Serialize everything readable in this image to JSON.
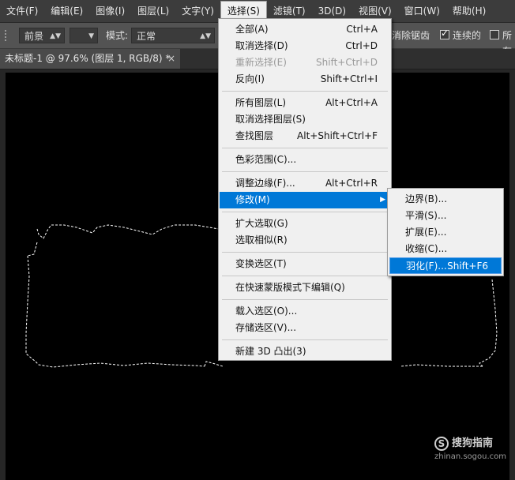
{
  "menubar": {
    "items": [
      {
        "label": "文件(F)"
      },
      {
        "label": "编辑(E)"
      },
      {
        "label": "图像(I)"
      },
      {
        "label": "图层(L)"
      },
      {
        "label": "文字(Y)"
      },
      {
        "label": "选择(S)",
        "active": true
      },
      {
        "label": "滤镜(T)"
      },
      {
        "label": "3D(D)"
      },
      {
        "label": "视图(V)"
      },
      {
        "label": "窗口(W)"
      },
      {
        "label": "帮助(H)"
      }
    ]
  },
  "options": {
    "fill_source": "前景",
    "mode_label": "模式:",
    "mode_value": "正常",
    "antialias_label": "消除锯齿",
    "contiguous_label": "连续的",
    "all_layers_label": "所有"
  },
  "document_tab": {
    "title": "未标题-1 @ 97.6% (图层 1, RGB/8) *",
    "close": "×"
  },
  "select_menu": {
    "items": [
      {
        "label": "全部(A)",
        "shortcut": "Ctrl+A"
      },
      {
        "label": "取消选择(D)",
        "shortcut": "Ctrl+D"
      },
      {
        "label": "重新选择(E)",
        "shortcut": "Shift+Ctrl+D"
      },
      {
        "label": "反向(I)",
        "shortcut": "Shift+Ctrl+I"
      },
      {
        "label": "所有图层(L)",
        "shortcut": "Alt+Ctrl+A"
      },
      {
        "label": "取消选择图层(S)",
        "shortcut": ""
      },
      {
        "label": "查找图层",
        "shortcut": "Alt+Shift+Ctrl+F"
      },
      {
        "label": "色彩范围(C)...",
        "shortcut": ""
      },
      {
        "label": "调整边缘(F)...",
        "shortcut": "Alt+Ctrl+R"
      },
      {
        "label": "修改(M)",
        "shortcut": ""
      },
      {
        "label": "扩大选取(G)",
        "shortcut": ""
      },
      {
        "label": "选取相似(R)",
        "shortcut": ""
      },
      {
        "label": "变换选区(T)",
        "shortcut": ""
      },
      {
        "label": "在快速蒙版模式下编辑(Q)",
        "shortcut": ""
      },
      {
        "label": "载入选区(O)...",
        "shortcut": ""
      },
      {
        "label": "存储选区(V)...",
        "shortcut": ""
      },
      {
        "label": "新建 3D 凸出(3)",
        "shortcut": ""
      }
    ],
    "submenu_arrow": "▶"
  },
  "modify_submenu": {
    "items": [
      {
        "label": "边界(B)...",
        "shortcut": ""
      },
      {
        "label": "平滑(S)...",
        "shortcut": ""
      },
      {
        "label": "扩展(E)...",
        "shortcut": ""
      },
      {
        "label": "收缩(C)...",
        "shortcut": ""
      },
      {
        "label": "羽化(F)...",
        "shortcut": "Shift+F6"
      }
    ]
  },
  "watermark": {
    "icon": "S",
    "brand": "搜狗指南",
    "url": "zhinan.sogou.com"
  },
  "colors": {
    "highlight": "#0078d7",
    "menu_bg": "#f0f0f0",
    "canvas": "#000000",
    "chrome": "#3c3c3c"
  }
}
